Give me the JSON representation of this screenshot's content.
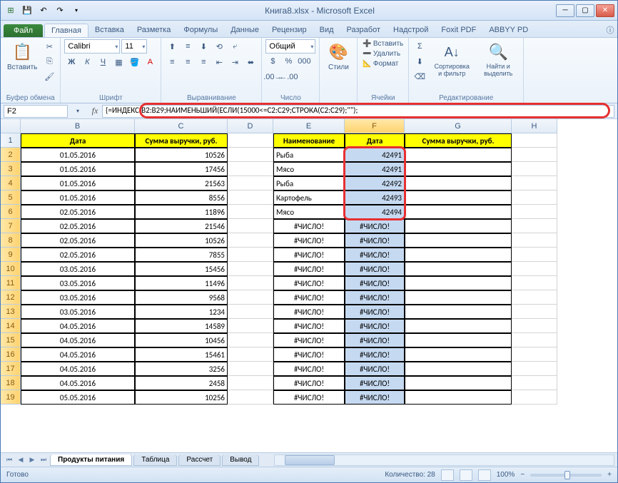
{
  "title": "Книга8.xlsx - Microsoft Excel",
  "qat": {
    "save": "💾",
    "undo": "↶",
    "redo": "↷"
  },
  "tabs": [
    "Главная",
    "Вставка",
    "Разметка",
    "Формулы",
    "Данные",
    "Рецензир",
    "Вид",
    "Разработ",
    "Надстрой",
    "Foxit PDF",
    "ABBYY PD"
  ],
  "file_tab": "Файл",
  "ribbon": {
    "clipboard": {
      "paste": "Вставить",
      "label": "Буфер обмена"
    },
    "font": {
      "name": "Calibri",
      "size": "11",
      "label": "Шрифт"
    },
    "align": {
      "label": "Выравнивание"
    },
    "number": {
      "format": "Общий",
      "label": "Число"
    },
    "styles": {
      "btn": "Стили"
    },
    "cells": {
      "insert": "Вставить",
      "delete": "Удалить",
      "format": "Формат",
      "label": "Ячейки"
    },
    "editing": {
      "sort": "Сортировка и фильтр",
      "find": "Найти и выделить",
      "label": "Редактирование"
    }
  },
  "namebox": "F2",
  "formula": "{=ИНДЕКС(B2:B29;НАИМЕНЬШИЙ(ЕСЛИ(15000<=C2:C29;СТРОКА(C2:C29);\"\");",
  "cols": [
    "B",
    "C",
    "D",
    "E",
    "F",
    "G",
    "H"
  ],
  "headers": {
    "b": "Дата",
    "c": "Сумма выручки, руб.",
    "e": "Наименование",
    "f": "Дата",
    "g": "Сумма выручки, руб."
  },
  "rows": [
    {
      "n": 2,
      "b": "01.05.2016",
      "c": "10526",
      "e": "Рыба",
      "f": "42491",
      "g": ""
    },
    {
      "n": 3,
      "b": "01.05.2016",
      "c": "17456",
      "e": "Мясо",
      "f": "42491",
      "g": ""
    },
    {
      "n": 4,
      "b": "01.05.2016",
      "c": "21563",
      "e": "Рыба",
      "f": "42492",
      "g": ""
    },
    {
      "n": 5,
      "b": "01.05.2016",
      "c": "8556",
      "e": "Картофель",
      "f": "42493",
      "g": ""
    },
    {
      "n": 6,
      "b": "02.05.2016",
      "c": "11896",
      "e": "Мясо",
      "f": "42494",
      "g": ""
    },
    {
      "n": 7,
      "b": "02.05.2016",
      "c": "21546",
      "e": "#ЧИСЛО!",
      "f": "#ЧИСЛО!",
      "g": ""
    },
    {
      "n": 8,
      "b": "02.05.2016",
      "c": "10526",
      "e": "#ЧИСЛО!",
      "f": "#ЧИСЛО!",
      "g": ""
    },
    {
      "n": 9,
      "b": "02.05.2016",
      "c": "7855",
      "e": "#ЧИСЛО!",
      "f": "#ЧИСЛО!",
      "g": ""
    },
    {
      "n": 10,
      "b": "03.05.2016",
      "c": "15456",
      "e": "#ЧИСЛО!",
      "f": "#ЧИСЛО!",
      "g": ""
    },
    {
      "n": 11,
      "b": "03.05.2016",
      "c": "11496",
      "e": "#ЧИСЛО!",
      "f": "#ЧИСЛО!",
      "g": ""
    },
    {
      "n": 12,
      "b": "03.05.2016",
      "c": "9568",
      "e": "#ЧИСЛО!",
      "f": "#ЧИСЛО!",
      "g": ""
    },
    {
      "n": 13,
      "b": "03.05.2016",
      "c": "1234",
      "e": "#ЧИСЛО!",
      "f": "#ЧИСЛО!",
      "g": ""
    },
    {
      "n": 14,
      "b": "04.05.2016",
      "c": "14589",
      "e": "#ЧИСЛО!",
      "f": "#ЧИСЛО!",
      "g": ""
    },
    {
      "n": 15,
      "b": "04.05.2016",
      "c": "10456",
      "e": "#ЧИСЛО!",
      "f": "#ЧИСЛО!",
      "g": ""
    },
    {
      "n": 16,
      "b": "04.05.2016",
      "c": "15461",
      "e": "#ЧИСЛО!",
      "f": "#ЧИСЛО!",
      "g": ""
    },
    {
      "n": 17,
      "b": "04.05.2016",
      "c": "3256",
      "e": "#ЧИСЛО!",
      "f": "#ЧИСЛО!",
      "g": ""
    },
    {
      "n": 18,
      "b": "04.05.2016",
      "c": "2458",
      "e": "#ЧИСЛО!",
      "f": "#ЧИСЛО!",
      "g": ""
    },
    {
      "n": 19,
      "b": "05.05.2016",
      "c": "10256",
      "e": "#ЧИСЛО!",
      "f": "#ЧИСЛО!",
      "g": ""
    }
  ],
  "sheets": [
    "Продукты питания",
    "Таблица",
    "Рассчет",
    "Вывод"
  ],
  "status": {
    "ready": "Готово",
    "count": "Количество: 28",
    "zoom": "100%"
  }
}
